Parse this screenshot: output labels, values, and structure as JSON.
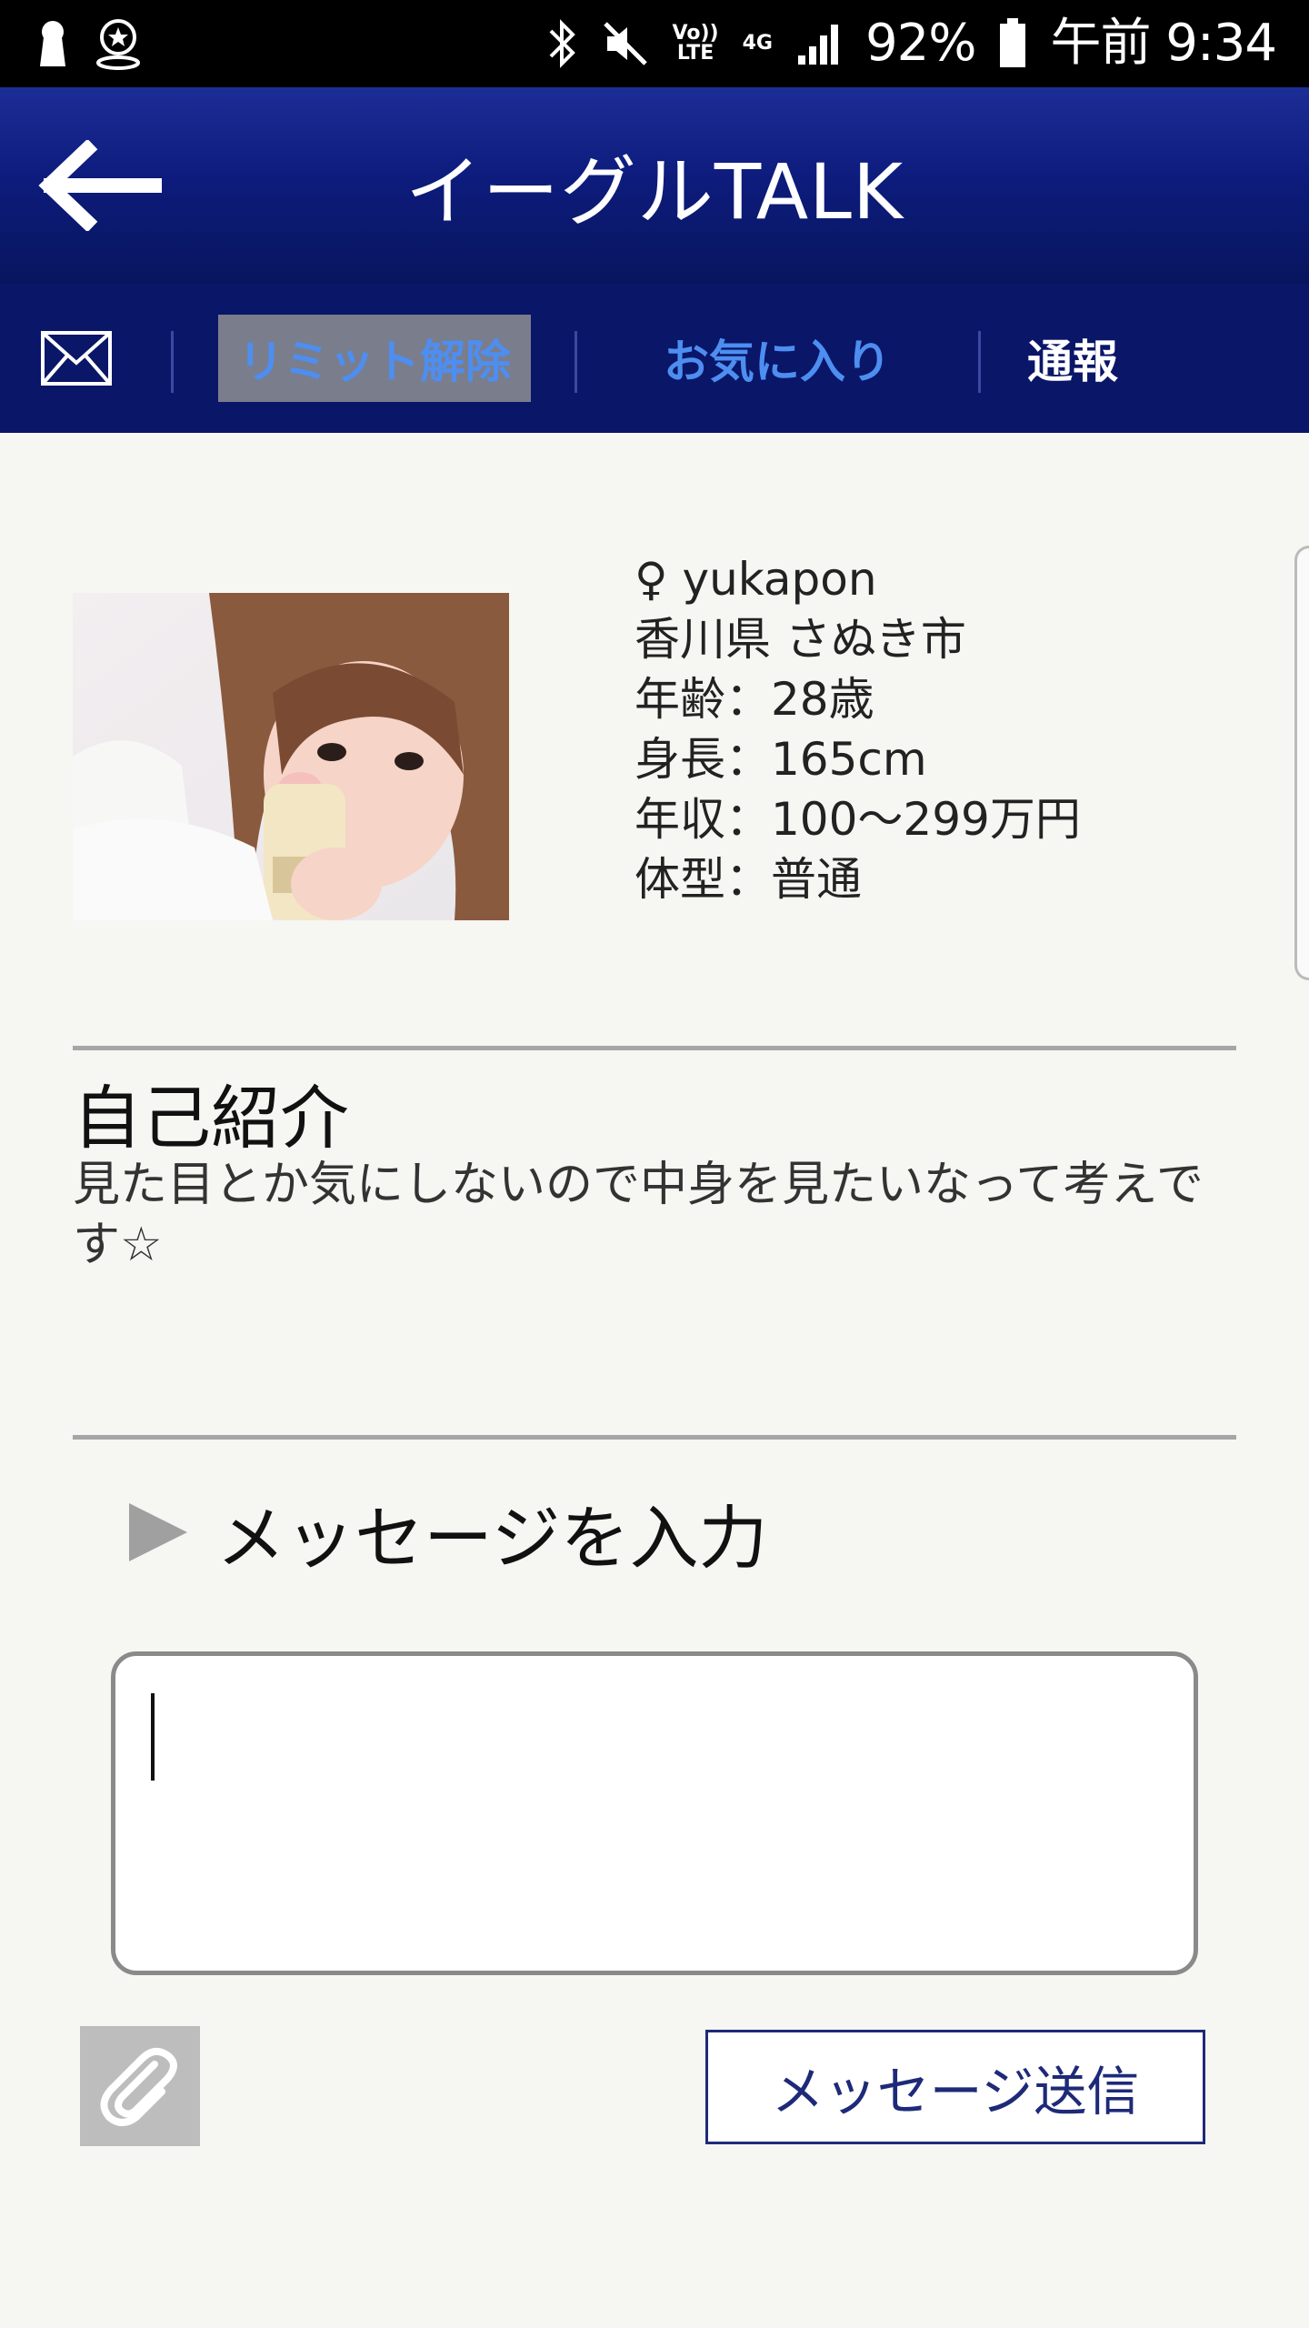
{
  "status_bar": {
    "battery": "92%",
    "time": "午前 9:34",
    "volte_label": "Vo))\nLTE",
    "network": "4G"
  },
  "header": {
    "title": "イーグルTALK"
  },
  "toolbar": {
    "limit_label": "リミット解除",
    "favorite_label": "お気に入り",
    "report_label": "通報"
  },
  "profile": {
    "name_line": "♀ yukapon",
    "location": "香川県 さぬき市",
    "age": "年齢：28歳",
    "height": "身長：165cm",
    "income": "年収：100〜299万円",
    "body_type": "体型：普通"
  },
  "intro": {
    "title": "自己紹介",
    "text": "見た目とか気にしないので中身を見たいなって考えです☆"
  },
  "message": {
    "heading": "メッセージを入力",
    "input_value": "",
    "send_label": "メッセージ送信"
  },
  "colors": {
    "header_blue": "#0d1c7d",
    "toolbar_blue": "#0a1668",
    "link_blue": "#4d8ef0",
    "send_border": "#1e2a78"
  }
}
